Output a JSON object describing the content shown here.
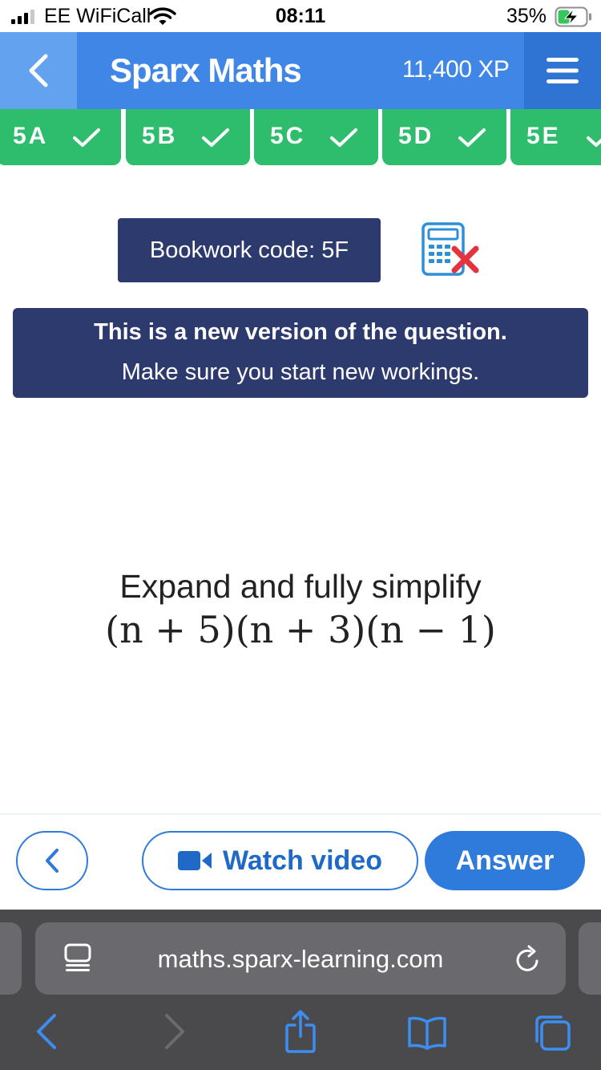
{
  "status_bar": {
    "carrier": "EE WiFiCall",
    "time": "08:11",
    "battery": "35%"
  },
  "header": {
    "title": "Sparx Maths",
    "xp": "11,400 XP"
  },
  "tabs": [
    {
      "label": "5A",
      "completed": true
    },
    {
      "label": "5B",
      "completed": true
    },
    {
      "label": "5C",
      "completed": true
    },
    {
      "label": "5D",
      "completed": true
    },
    {
      "label": "5E",
      "completed": true
    }
  ],
  "bookwork": {
    "label": "Bookwork code: 5F",
    "calculator": "calculator-not-allowed-icon"
  },
  "notice": {
    "line1": "This is a new version of the question.",
    "line2": "Make sure you start new workings."
  },
  "question": {
    "instruction": "Expand and fully simplify",
    "expression": "(n + 5)(n + 3)(n − 1)"
  },
  "actions": {
    "watch_video": "Watch video",
    "answer": "Answer"
  },
  "browser": {
    "url": "maths.sparx-learning.com"
  },
  "colors": {
    "header_blue": "#3f86e6",
    "tab_green": "#2dbd6d",
    "navy": "#2c3a6e",
    "button_blue": "#2f7bdc",
    "error_red": "#e5323f"
  }
}
